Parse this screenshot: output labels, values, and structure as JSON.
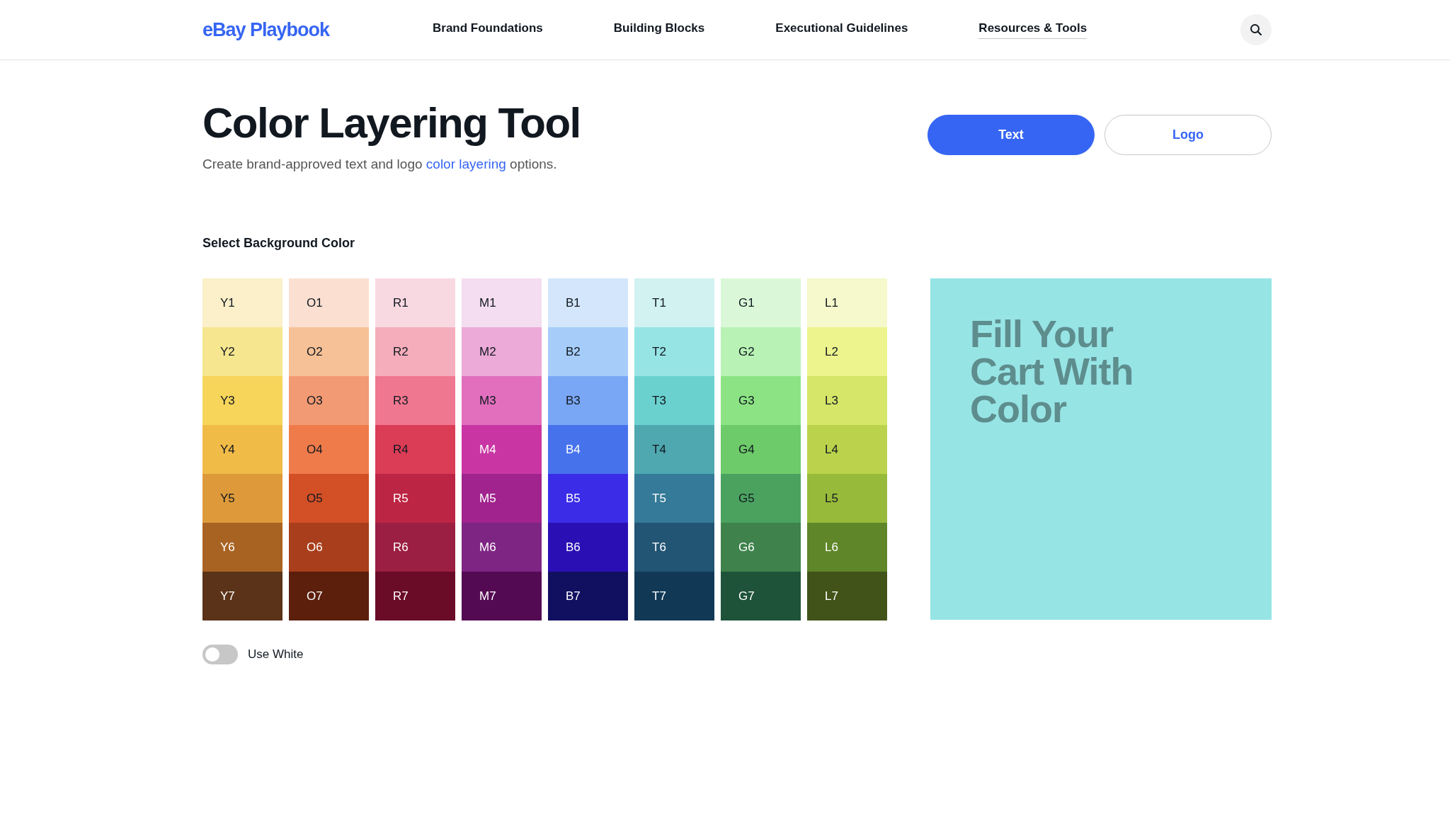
{
  "header": {
    "logo": "eBay Playbook",
    "nav": [
      {
        "label": "Brand Foundations",
        "selected": false
      },
      {
        "label": "Building Blocks",
        "selected": false
      },
      {
        "label": "Executional Guidelines",
        "selected": false
      },
      {
        "label": "Resources & Tools",
        "selected": true
      }
    ]
  },
  "page": {
    "title": "Color Layering Tool",
    "subtitle_before": "Create brand-approved text and logo ",
    "subtitle_link": "color layering",
    "subtitle_after": " options.",
    "modes": [
      {
        "label": "Text",
        "selected": true
      },
      {
        "label": "Logo",
        "selected": false
      }
    ]
  },
  "section_label": "Select Background Color",
  "swatch_columns": [
    {
      "swatches": [
        {
          "label": "Y1",
          "color": "#fbf0c9",
          "light_label": false
        },
        {
          "label": "Y2",
          "color": "#f5e68f",
          "light_label": false
        },
        {
          "label": "Y3",
          "color": "#f6d55a",
          "light_label": false
        },
        {
          "label": "Y4",
          "color": "#f1bb47",
          "light_label": false
        },
        {
          "label": "Y5",
          "color": "#de9a3a",
          "light_label": false
        },
        {
          "label": "Y6",
          "color": "#a86322",
          "light_label": true
        },
        {
          "label": "Y7",
          "color": "#5b3318",
          "light_label": true
        }
      ]
    },
    {
      "swatches": [
        {
          "label": "O1",
          "color": "#fbe0d1",
          "light_label": false
        },
        {
          "label": "O2",
          "color": "#f6c196",
          "light_label": false
        },
        {
          "label": "O3",
          "color": "#f29a73",
          "light_label": false
        },
        {
          "label": "O4",
          "color": "#ef7b4a",
          "light_label": false
        },
        {
          "label": "O5",
          "color": "#d34f26",
          "light_label": false
        },
        {
          "label": "O6",
          "color": "#a83e1b",
          "light_label": true
        },
        {
          "label": "O7",
          "color": "#5b1f0c",
          "light_label": true
        }
      ]
    },
    {
      "swatches": [
        {
          "label": "R1",
          "color": "#f9d9e1",
          "light_label": false
        },
        {
          "label": "R2",
          "color": "#f5adbb",
          "light_label": false
        },
        {
          "label": "R3",
          "color": "#f07790",
          "light_label": false
        },
        {
          "label": "R4",
          "color": "#db3c56",
          "light_label": false
        },
        {
          "label": "R5",
          "color": "#bd2544",
          "light_label": true
        },
        {
          "label": "R6",
          "color": "#9b1f42",
          "light_label": true
        },
        {
          "label": "R7",
          "color": "#6a0b28",
          "light_label": true
        }
      ]
    },
    {
      "swatches": [
        {
          "label": "M1",
          "color": "#f4ddf0",
          "light_label": false
        },
        {
          "label": "M2",
          "color": "#ecaad8",
          "light_label": false
        },
        {
          "label": "M3",
          "color": "#e16fbe",
          "light_label": false
        },
        {
          "label": "M4",
          "color": "#c936a4",
          "light_label": true
        },
        {
          "label": "M5",
          "color": "#a0238e",
          "light_label": true
        },
        {
          "label": "M6",
          "color": "#7e2584",
          "light_label": true
        },
        {
          "label": "M7",
          "color": "#540a53",
          "light_label": true
        }
      ]
    },
    {
      "swatches": [
        {
          "label": "B1",
          "color": "#d3e6fb",
          "light_label": false
        },
        {
          "label": "B2",
          "color": "#a6cdf9",
          "light_label": false
        },
        {
          "label": "B3",
          "color": "#7aa7f5",
          "light_label": false
        },
        {
          "label": "B4",
          "color": "#4672ec",
          "light_label": true
        },
        {
          "label": "B5",
          "color": "#3a2ce7",
          "light_label": true
        },
        {
          "label": "B6",
          "color": "#2a0fb4",
          "light_label": true
        },
        {
          "label": "B7",
          "color": "#111060",
          "light_label": true
        }
      ]
    },
    {
      "swatches": [
        {
          "label": "T1",
          "color": "#d1f2f1",
          "light_label": false
        },
        {
          "label": "T2",
          "color": "#97e4e5",
          "light_label": false
        },
        {
          "label": "T3",
          "color": "#6bd1cf",
          "light_label": false
        },
        {
          "label": "T4",
          "color": "#4fa8b0",
          "light_label": false
        },
        {
          "label": "T5",
          "color": "#357a98",
          "light_label": true
        },
        {
          "label": "T6",
          "color": "#225474",
          "light_label": true
        },
        {
          "label": "T7",
          "color": "#113956",
          "light_label": true
        }
      ]
    },
    {
      "swatches": [
        {
          "label": "G1",
          "color": "#daf8d8",
          "light_label": false
        },
        {
          "label": "G2",
          "color": "#b8f2b4",
          "light_label": false
        },
        {
          "label": "G3",
          "color": "#8ce384",
          "light_label": false
        },
        {
          "label": "G4",
          "color": "#6ecb6a",
          "light_label": false
        },
        {
          "label": "G5",
          "color": "#4ba25f",
          "light_label": false
        },
        {
          "label": "G6",
          "color": "#3f824c",
          "light_label": true
        },
        {
          "label": "G7",
          "color": "#1f5339",
          "light_label": true
        }
      ]
    },
    {
      "swatches": [
        {
          "label": "L1",
          "color": "#f5f9cb",
          "light_label": false
        },
        {
          "label": "L2",
          "color": "#eef48d",
          "light_label": false
        },
        {
          "label": "L3",
          "color": "#d5e668",
          "light_label": false
        },
        {
          "label": "L4",
          "color": "#bbd34c",
          "light_label": false
        },
        {
          "label": "L5",
          "color": "#97ba3b",
          "light_label": false
        },
        {
          "label": "L6",
          "color": "#5f8628",
          "light_label": true
        },
        {
          "label": "L7",
          "color": "#415318",
          "light_label": true
        }
      ]
    }
  ],
  "preview": {
    "color": "#97e4e5",
    "headline": "Fill Your Cart With Color"
  },
  "use_white": {
    "label": "Use White",
    "on": false
  }
}
